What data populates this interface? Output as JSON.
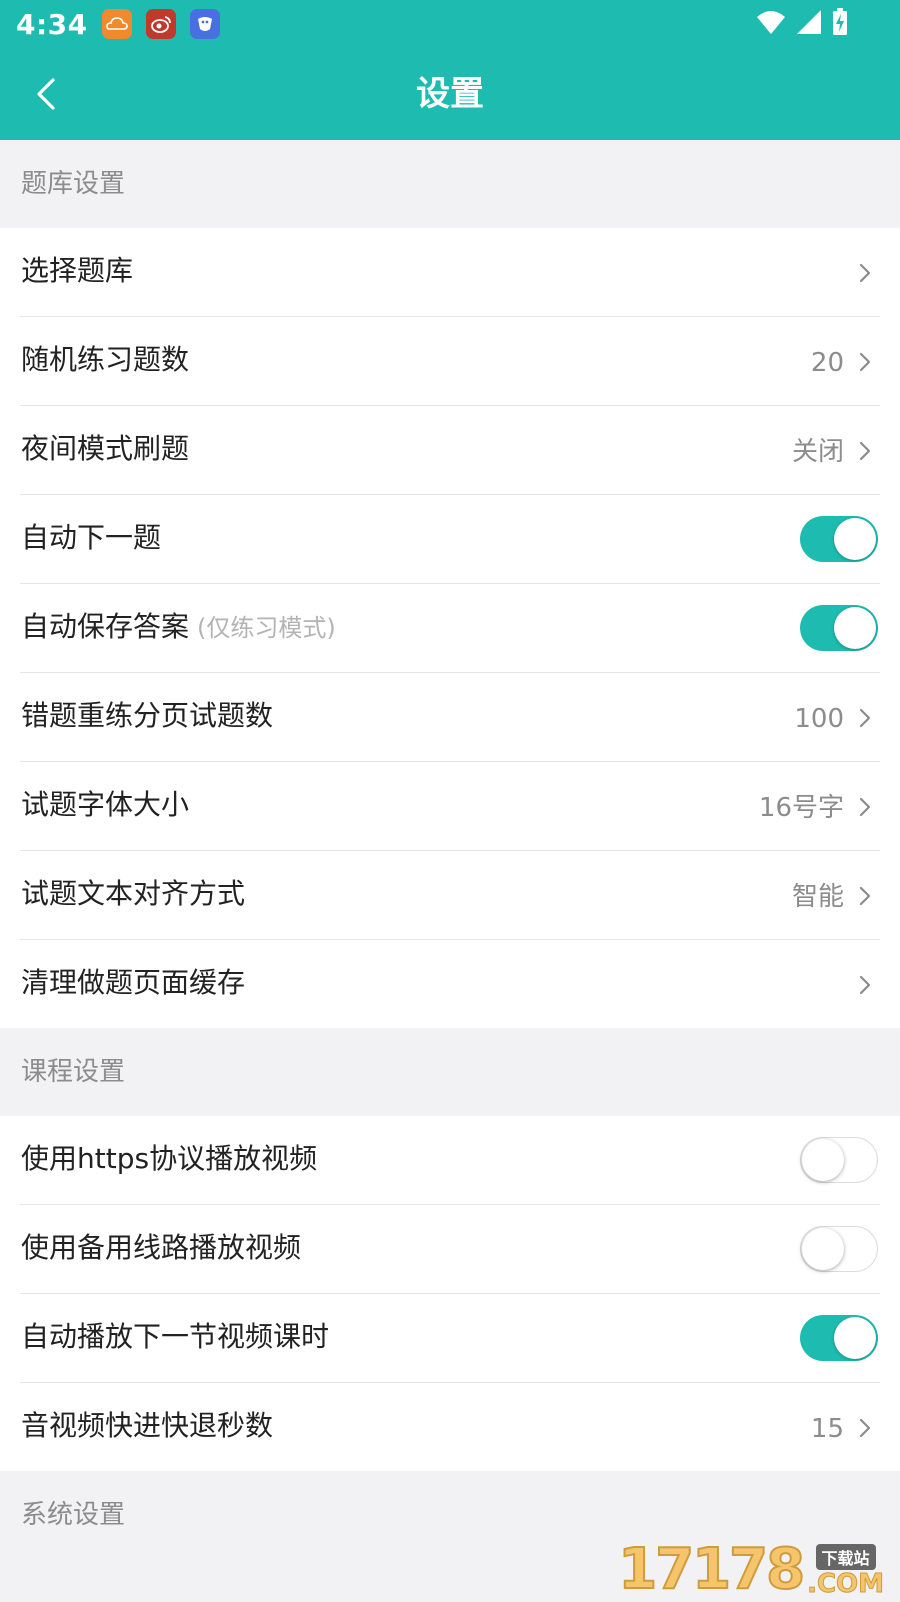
{
  "status_bar": {
    "time": "4:34",
    "app_icons": [
      {
        "name": "weather-app-icon",
        "color": "#f08a2c"
      },
      {
        "name": "weibo-app-icon",
        "color": "#c0392b"
      },
      {
        "name": "bird-app-icon",
        "color": "#4a6fe0"
      }
    ],
    "indicators": [
      "wifi-icon",
      "signal-icon",
      "battery-charging-icon"
    ]
  },
  "header": {
    "title": "设置",
    "back_icon": "back-chevron-icon"
  },
  "sections": [
    {
      "title": "题库设置",
      "items": [
        {
          "label": "选择题库",
          "value": "",
          "control": "chevron"
        },
        {
          "label": "随机练习题数",
          "value": "20",
          "control": "chevron"
        },
        {
          "label": "夜间模式刷题",
          "value": "关闭",
          "control": "chevron"
        },
        {
          "label": "自动下一题",
          "control": "toggle",
          "on": true
        },
        {
          "label": "自动保存答案",
          "hint": "(仅练习模式)",
          "control": "toggle",
          "on": true
        },
        {
          "label": "错题重练分页试题数",
          "value": "100",
          "control": "chevron"
        },
        {
          "label": "试题字体大小",
          "value": "16号字",
          "control": "chevron"
        },
        {
          "label": "试题文本对齐方式",
          "value": "智能",
          "control": "chevron"
        },
        {
          "label": "清理做题页面缓存",
          "value": "",
          "control": "chevron"
        }
      ]
    },
    {
      "title": "课程设置",
      "items": [
        {
          "label": "使用https协议播放视频",
          "control": "toggle",
          "on": false
        },
        {
          "label": "使用备用线路播放视频",
          "control": "toggle",
          "on": false
        },
        {
          "label": "自动播放下一节视频课时",
          "control": "toggle",
          "on": true
        },
        {
          "label": "音视频快进快退秒数",
          "value": "15",
          "control": "chevron"
        }
      ]
    },
    {
      "title": "系统设置",
      "items": []
    }
  ],
  "watermark": {
    "number": "17178",
    "cn": "下载站",
    "com": ".COM"
  },
  "colors": {
    "accent": "#1dbbb0",
    "background": "#f2f2f4"
  }
}
